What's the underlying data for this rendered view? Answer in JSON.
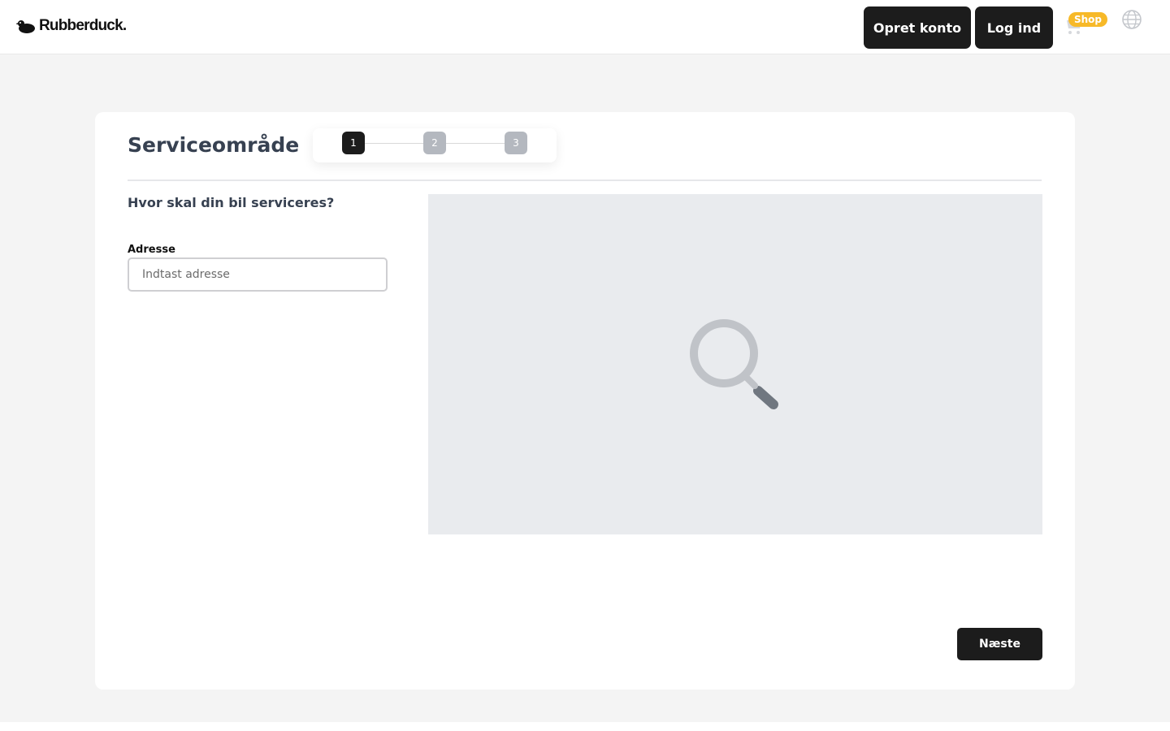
{
  "header": {
    "brand": "Rubberduck.",
    "signup_label": "Opret konto",
    "login_label": "Log ind",
    "shop_badge": "Shop",
    "icons": {
      "logo": "duck-logo-icon",
      "cart": "cart-icon",
      "language": "globe-icon"
    }
  },
  "form": {
    "title": "Serviceområde",
    "steps": [
      "1",
      "2",
      "3"
    ],
    "active_step": 1,
    "question": "Hvor skal din bil serviceres?",
    "address_label": "Adresse",
    "address_placeholder": "Indtast adresse",
    "address_value": "",
    "next_label": "Næste"
  },
  "map": {
    "icon": "magnifier-icon"
  },
  "colors": {
    "primary": "#1c1c1c",
    "badge": "#f7b928",
    "step_inactive": "#b4b8bf",
    "map_background": "#e9ebee",
    "page_background": "#f4f4f4"
  }
}
